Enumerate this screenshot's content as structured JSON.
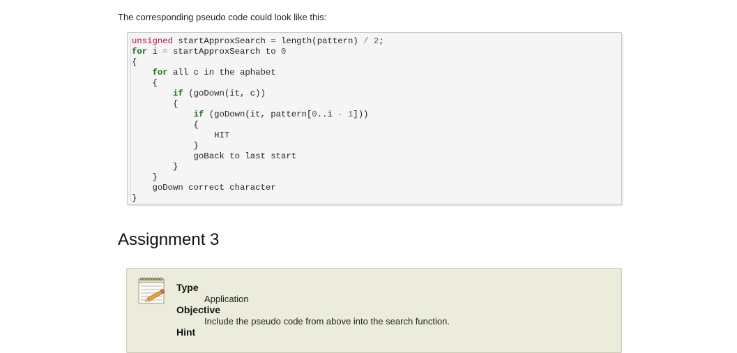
{
  "intro_text": "The corresponding pseudo code could look like this:",
  "code": {
    "l1_type": "unsigned",
    "l1_rest": " startApproxSearch ",
    "l1_op": "=",
    "l1_expr": " length(pattern) ",
    "l1_div": "/",
    "l1_num": " 2",
    "l1_semi": ";",
    "l2_for": "for",
    "l2_a": " i ",
    "l2_op": "=",
    "l2_b": " startApproxSearch to ",
    "l2_num": "0",
    "l3": "{",
    "l4_indent": "    ",
    "l4_for": "for",
    "l4_rest": " all c in the aphabet",
    "l5": "    {",
    "l6_indent": "        ",
    "l6_if": "if",
    "l6_rest": " (goDown(it, c))",
    "l7": "        {",
    "l8_indent": "            ",
    "l8_if": "if",
    "l8_a": " (goDown(it, pattern[",
    "l8_num0": "0",
    "l8_b": "..i ",
    "l8_op": "-",
    "l8_num1": " 1",
    "l8_c": "]))",
    "l9": "            {",
    "l10": "                HIT",
    "l11": "            }",
    "l12": "            goBack to last start",
    "l13": "        }",
    "l14": "    }",
    "l15": "    goDown correct character",
    "l16": "}"
  },
  "section_title": "Assignment 3",
  "assignment": {
    "icon": "notepad-pencil-icon",
    "type_label": "Type",
    "type_value": "Application",
    "objective_label": "Objective",
    "objective_value": "Include the pseudo code from above into the search function.",
    "hint_label": "Hint"
  }
}
